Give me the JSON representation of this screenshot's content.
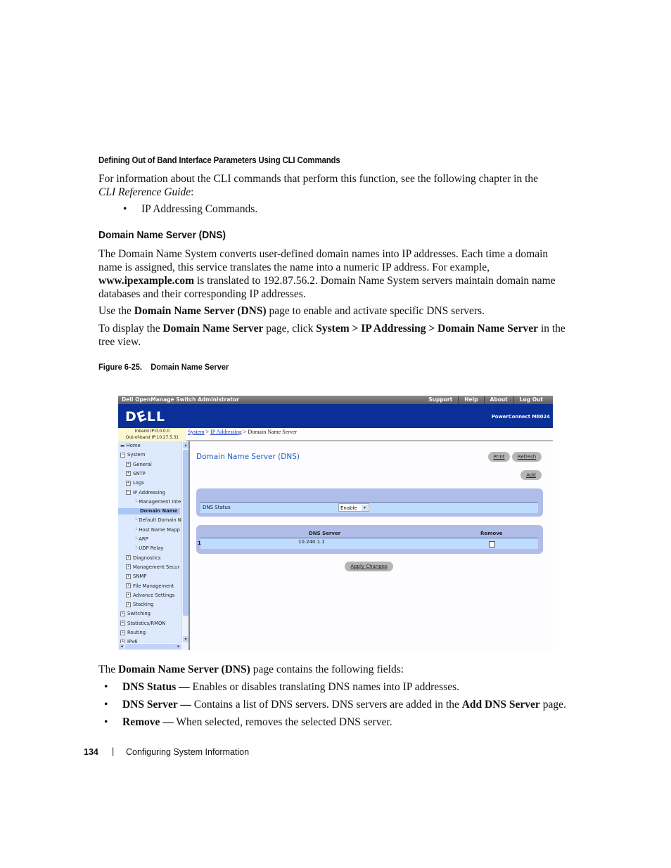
{
  "doc": {
    "heading_cli": "Defining Out of Band Interface Parameters Using CLI Commands",
    "cli_para_1": "For information about the CLI commands that perform this function, see the following chapter in the",
    "cli_para_2_italic": "CLI Reference Guide",
    "cli_para_2_rest": ":",
    "cli_bullet": "IP Addressing Commands.",
    "section_title": "Domain Name Server (DNS)",
    "dns_para_line1": "The Domain Name System converts user-defined domain names into IP addresses. Each time a domain",
    "dns_para_line2": "name is assigned, this service translates the name into a numeric IP address. For example,",
    "dns_para_line3_bold": "www.ipexample.com",
    "dns_para_line3_rest": " is translated to 192.87.56.2. Domain Name System servers maintain domain name",
    "dns_para_line4": "databases and their corresponding IP addresses.",
    "use_pre": "Use the ",
    "use_bold": "Domain Name Server (DNS)",
    "use_post": " page to enable and activate specific DNS servers.",
    "display_pre": "To display the ",
    "display_bold1": "Domain Name Server",
    "display_mid": " page, click ",
    "display_bold2": "System > IP Addressing > Domain Name Server",
    "display_post": " in the",
    "display_line2": "tree view.",
    "figure_caption": "Figure 6-25.    Domain Name Server",
    "fields_pre": "The ",
    "fields_bold": "Domain Name Server (DNS)",
    "fields_post": " page contains the following fields:",
    "fields": [
      {
        "term": "DNS Status —",
        "desc": " Enables or disables translating DNS names into IP addresses.",
        "extra_bold": "",
        "extra_post": ""
      },
      {
        "term": "DNS Server —",
        "desc": " Contains a list of DNS servers. DNS servers are added in the ",
        "extra_bold": "Add DNS Server",
        "extra_post": " page."
      },
      {
        "term": "Remove —",
        "desc": " When selected, removes the selected DNS server.",
        "extra_bold": "",
        "extra_post": ""
      }
    ],
    "page_number": "134",
    "footer_sep": "|",
    "footer_title": "Configuring System Information",
    "bullet_glyph": "•"
  },
  "screenshot": {
    "app_title": "Dell OpenManage Switch Administrator",
    "top_links": [
      "Support",
      "Help",
      "About",
      "Log Out"
    ],
    "logo": "DƐLL",
    "model": "PowerConnect M8024",
    "inband_ip": "Inband IP:0.0.0.0",
    "oob_ip": "Out-of-band IP:10.27.5.31",
    "breadcrumb": {
      "items": [
        "System",
        "IP Addressing"
      ],
      "current": "Domain Name Server",
      "sep": " > "
    },
    "tree": [
      {
        "label": "Home",
        "level": 0,
        "icon": "home"
      },
      {
        "label": "System",
        "level": 0,
        "icon": "minus"
      },
      {
        "label": "General",
        "level": 1,
        "icon": "plus"
      },
      {
        "label": "SNTP",
        "level": 1,
        "icon": "plus"
      },
      {
        "label": "Logs",
        "level": 1,
        "icon": "plus"
      },
      {
        "label": "IP Addressing",
        "level": 1,
        "icon": "minus"
      },
      {
        "label": "Management Inte",
        "level": 2,
        "icon": "leaf"
      },
      {
        "label": "Domain Name",
        "level": 2,
        "icon": "leaf",
        "selected": true
      },
      {
        "label": "Default Domain N",
        "level": 2,
        "icon": "leaf"
      },
      {
        "label": "Host Name Mapp",
        "level": 2,
        "icon": "leaf"
      },
      {
        "label": "ARP",
        "level": 2,
        "icon": "leaf"
      },
      {
        "label": "UDP Relay",
        "level": 2,
        "icon": "leaf"
      },
      {
        "label": "Diagnostics",
        "level": 1,
        "icon": "plus"
      },
      {
        "label": "Management Secur",
        "level": 1,
        "icon": "plus"
      },
      {
        "label": "SNMP",
        "level": 1,
        "icon": "plus"
      },
      {
        "label": "File Management",
        "level": 1,
        "icon": "plus"
      },
      {
        "label": "Advance Settings",
        "level": 1,
        "icon": "plus"
      },
      {
        "label": "Stacking",
        "level": 1,
        "icon": "plus"
      },
      {
        "label": "Switching",
        "level": 0,
        "icon": "plus"
      },
      {
        "label": "Statistics/RMON",
        "level": 0,
        "icon": "plus"
      },
      {
        "label": "Routing",
        "level": 0,
        "icon": "plus"
      },
      {
        "label": "IPv6",
        "level": 0,
        "icon": "plus"
      }
    ],
    "page_title": "Domain Name Server (DNS)",
    "buttons": {
      "print": "Print",
      "refresh": "Refresh",
      "add": "Add",
      "apply": "Apply Changes"
    },
    "dns_status_label": "DNS Status",
    "dns_status_value": "Enable",
    "table": {
      "headers": [
        "DNS Server",
        "Remove"
      ],
      "rows": [
        {
          "index": "1",
          "server": "10.240.1.1",
          "remove": false
        }
      ]
    }
  }
}
